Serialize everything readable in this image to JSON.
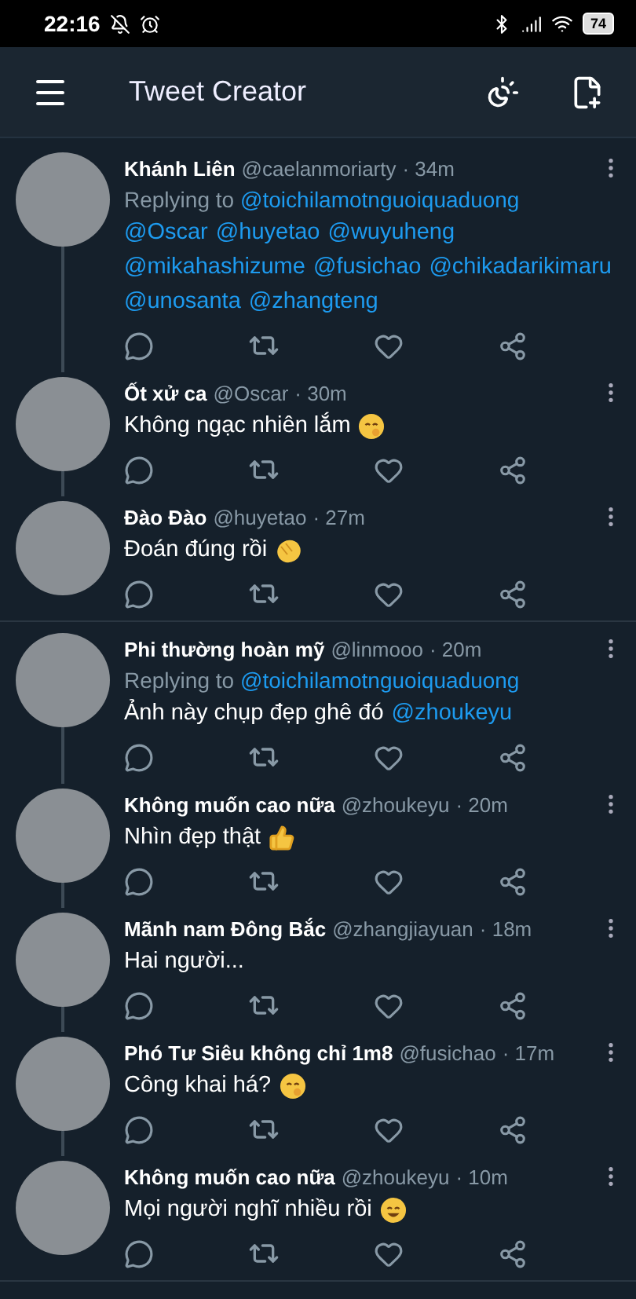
{
  "status_bar": {
    "time": "22:16",
    "battery": "74"
  },
  "app_bar": {
    "title": "Tweet Creator"
  },
  "threads": [
    {
      "tweets": [
        {
          "name": "Khánh Liên",
          "handle": "@caelanmoriarty",
          "time": "· 34m",
          "replying_label": "Replying to",
          "replying_to": "@toichilamotnguoiquaduong",
          "body": [
            {
              "kind": "mention",
              "text": "@Oscar"
            },
            {
              "kind": "mention",
              "text": "@huyetao"
            },
            {
              "kind": "mention",
              "text": "@wuyuheng"
            },
            {
              "kind": "mention",
              "text": "@mikahashizume"
            },
            {
              "kind": "mention",
              "text": "@fusichao"
            },
            {
              "kind": "mention",
              "text": "@chikadarikimaru"
            },
            {
              "kind": "mention",
              "text": "@unosanta"
            },
            {
              "kind": "mention",
              "text": "@zhangteng"
            }
          ]
        },
        {
          "name": "Ốt xử ca",
          "handle": "@Oscar",
          "time": "· 30m",
          "body": [
            {
              "kind": "plain",
              "text": "Không ngạc nhiên lắm"
            }
          ],
          "emoji": {
            "kind": "face"
          }
        },
        {
          "name": "Đào Đào",
          "handle": "@huyetao",
          "time": "· 27m",
          "body": [
            {
              "kind": "plain",
              "text": "Đoán đúng rồi"
            }
          ],
          "emoji": {
            "kind": "clap"
          }
        }
      ]
    },
    {
      "tweets": [
        {
          "name": "Phi thường hoàn mỹ",
          "handle": "@linmooo",
          "time": "· 20m",
          "replying_label": "Replying to",
          "replying_to": "@toichilamotnguoiquaduong",
          "body": [
            {
              "kind": "plain",
              "text": "Ảnh này chụp đẹp ghê đó"
            },
            {
              "kind": "mention",
              "text": "@zhoukeyu"
            }
          ]
        },
        {
          "name": "Không muốn cao nữa",
          "handle": "@zhoukeyu",
          "time": "· 20m",
          "body": [
            {
              "kind": "plain",
              "text": "Nhìn đẹp thật"
            }
          ],
          "emoji": {
            "kind": "thumbs"
          }
        },
        {
          "name": "Mãnh nam Đông Bắc",
          "handle": "@zhangjiayuan",
          "time": "· 18m",
          "body": [
            {
              "kind": "plain",
              "text": "Hai người..."
            }
          ]
        },
        {
          "name": "Phó Tư Siêu không chỉ 1m8",
          "handle": "@fusichao",
          "time": "· 17m",
          "body": [
            {
              "kind": "plain",
              "text": "Công khai há?"
            }
          ],
          "emoji": {
            "kind": "face"
          }
        },
        {
          "name": "Không muốn cao nữa",
          "handle": "@zhoukeyu",
          "time": "· 10m",
          "body": [
            {
              "kind": "plain",
              "text": "Mọi người nghĩ nhiều rồi"
            }
          ],
          "emoji": {
            "kind": "laugh"
          }
        }
      ]
    }
  ]
}
